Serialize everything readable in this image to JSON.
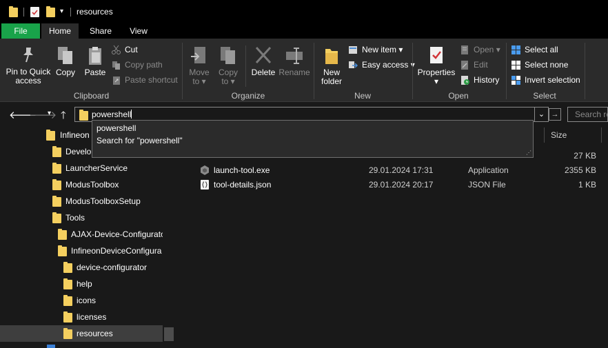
{
  "title": {
    "text": "resources"
  },
  "tabs": [
    {
      "label": "File"
    },
    {
      "label": "Home"
    },
    {
      "label": "Share"
    },
    {
      "label": "View"
    }
  ],
  "ribbon": {
    "clipboard": {
      "label": "Clipboard",
      "pin_l1": "Pin to Quick",
      "pin_l2": "access",
      "copy": "Copy",
      "paste": "Paste",
      "cut": "Cut",
      "copy_path": "Copy path",
      "paste_shortcut": "Paste shortcut"
    },
    "organize": {
      "label": "Organize",
      "move_l1": "Move",
      "move_l2": "to",
      "copy_l1": "Copy",
      "copy_l2": "to",
      "delete": "Delete",
      "rename": "Rename"
    },
    "new": {
      "label": "New",
      "folder_l1": "New",
      "folder_l2": "folder",
      "new_item": "New item",
      "easy_access": "Easy access"
    },
    "open": {
      "label": "Open",
      "properties": "Properties",
      "open": "Open",
      "edit": "Edit",
      "history": "History"
    },
    "select": {
      "label": "Select",
      "select_all": "Select all",
      "select_none": "Select none",
      "invert": "Invert selection"
    }
  },
  "address": {
    "value": "powershell",
    "search_placeholder": "Search re"
  },
  "autocomplete": [
    {
      "text": "powershell"
    },
    {
      "text": "Search for \"powershell\""
    }
  ],
  "nav_tree": [
    {
      "label": "Infineon"
    },
    {
      "label": "Develop"
    },
    {
      "label": "LauncherService"
    },
    {
      "label": "ModusToolbox"
    },
    {
      "label": "ModusToolboxSetup"
    },
    {
      "label": "Tools"
    },
    {
      "label": "AJAX-Device-Configurato"
    },
    {
      "label": "InfineonDeviceConfigura"
    },
    {
      "label": "device-configurator"
    },
    {
      "label": "help"
    },
    {
      "label": "icons"
    },
    {
      "label": "licenses"
    },
    {
      "label": "resources"
    }
  ],
  "columns": {
    "size": "Size"
  },
  "files": [
    {
      "name": "",
      "date": "",
      "type": "",
      "size": "27 KB"
    },
    {
      "name": "launch-tool.exe",
      "date": "29.01.2024 17:31",
      "type": "Application",
      "size": "2355 KB"
    },
    {
      "name": "tool-details.json",
      "date": "29.01.2024 20:17",
      "type": "JSON File",
      "size": "1 KB"
    }
  ],
  "colors": {
    "file_tab": "#19a34a",
    "folder": "#f4cf5f",
    "background": "#191919",
    "ribbon": "#2b2b2b"
  }
}
